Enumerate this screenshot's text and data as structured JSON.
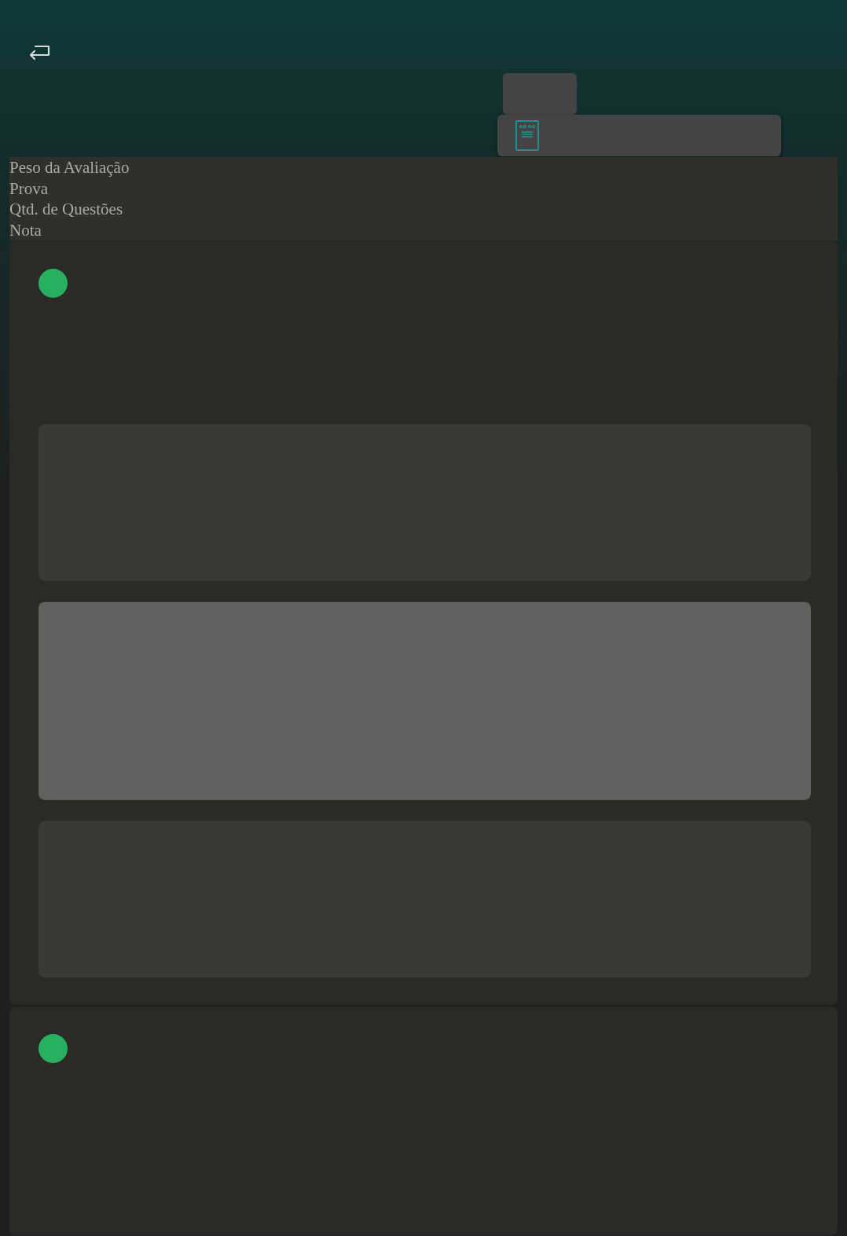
{
  "header": {
    "labels": [
      "Peso da Avaliação",
      "Prova",
      "Qtd. de Questões",
      "Nota"
    ]
  },
  "cards": [
    {
      "color": "#27b060",
      "options": [
        {
          "selected": false
        },
        {
          "selected": true
        },
        {
          "selected": false
        }
      ]
    },
    {
      "color": "#27b060"
    }
  ]
}
